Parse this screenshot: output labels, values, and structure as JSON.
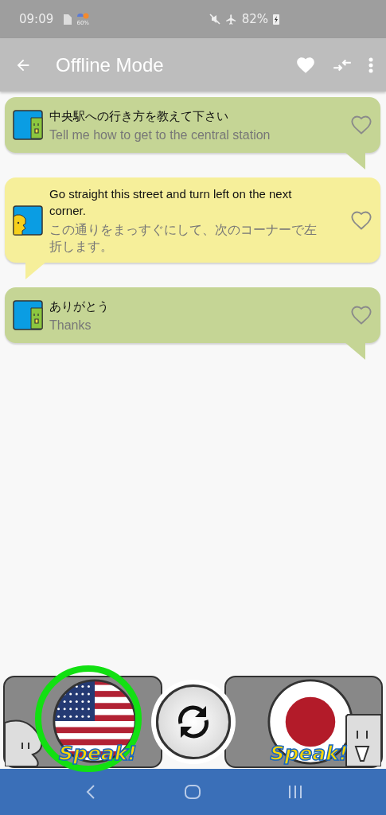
{
  "status_bar": {
    "time": "09:09",
    "weather_percent": "60%",
    "battery": "82%"
  },
  "app_bar": {
    "title": "Offline Mode"
  },
  "messages": [
    {
      "kind": "mine",
      "primary": "中央駅への行き方を教えて下さい",
      "secondary": "Tell me how to get to the central station",
      "favorite": false
    },
    {
      "kind": "theirs",
      "primary": "Go straight this street and turn left on the next corner.",
      "secondary": "この通りをまっすぐにして、次のコーナーで左折します。",
      "favorite": false
    },
    {
      "kind": "mine",
      "primary": "ありがとう",
      "secondary": "Thanks",
      "favorite": false
    }
  ],
  "speak_buttons": [
    {
      "kind": "english",
      "label": "Speak!",
      "selected": true
    },
    {
      "kind": "japanese",
      "label": "Speak!",
      "selected": false
    }
  ]
}
